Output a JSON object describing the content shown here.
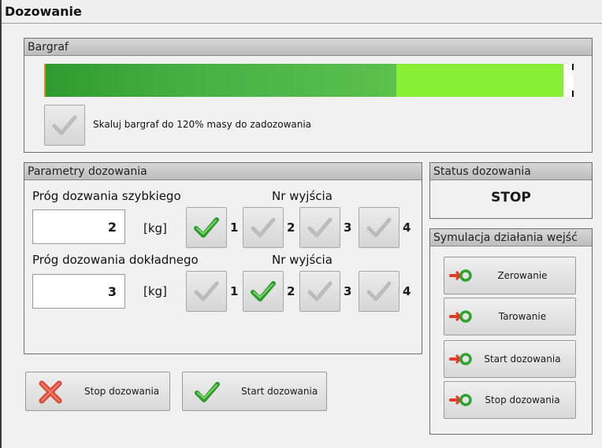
{
  "window": {
    "title": "Dozowanie"
  },
  "bargraf": {
    "header": "Bargraf",
    "dark_fill_fraction": 0.665,
    "light_fill_fraction": 0.98,
    "scale_checkbox": {
      "label": "Skaluj bargraf do 120% masy do zadozowania",
      "checked": false
    }
  },
  "params": {
    "header": "Parametry dozowania",
    "fast": {
      "label": "Próg dozwania szybkiego",
      "outputs_label": "Nr wyjścia",
      "value": "2",
      "unit": "[kg]",
      "outputs": [
        {
          "num": "1",
          "checked": true
        },
        {
          "num": "2",
          "checked": false
        },
        {
          "num": "3",
          "checked": false
        },
        {
          "num": "4",
          "checked": false
        }
      ]
    },
    "precise": {
      "label": "Próg dozowania dokładnego",
      "outputs_label": "Nr wyjścia",
      "value": "3",
      "unit": "[kg]",
      "outputs": [
        {
          "num": "1",
          "checked": false
        },
        {
          "num": "2",
          "checked": true
        },
        {
          "num": "3",
          "checked": false
        },
        {
          "num": "4",
          "checked": false
        }
      ]
    }
  },
  "buttons": {
    "stop": "Stop dozowania",
    "start": "Start dozowania"
  },
  "status": {
    "header": "Status dozowania",
    "value": "STOP"
  },
  "simulation": {
    "header": "Symulacja działania wejść",
    "buttons": [
      "Zerowanie",
      "Tarowanie",
      "Start dozowania",
      "Stop dozowania"
    ]
  },
  "colors": {
    "check_active": "#3aa83a",
    "check_inactive": "#b9b9b9",
    "stop_red": "#e04a3a",
    "bar_dark": "#46b044",
    "bar_light": "#88ef36"
  }
}
